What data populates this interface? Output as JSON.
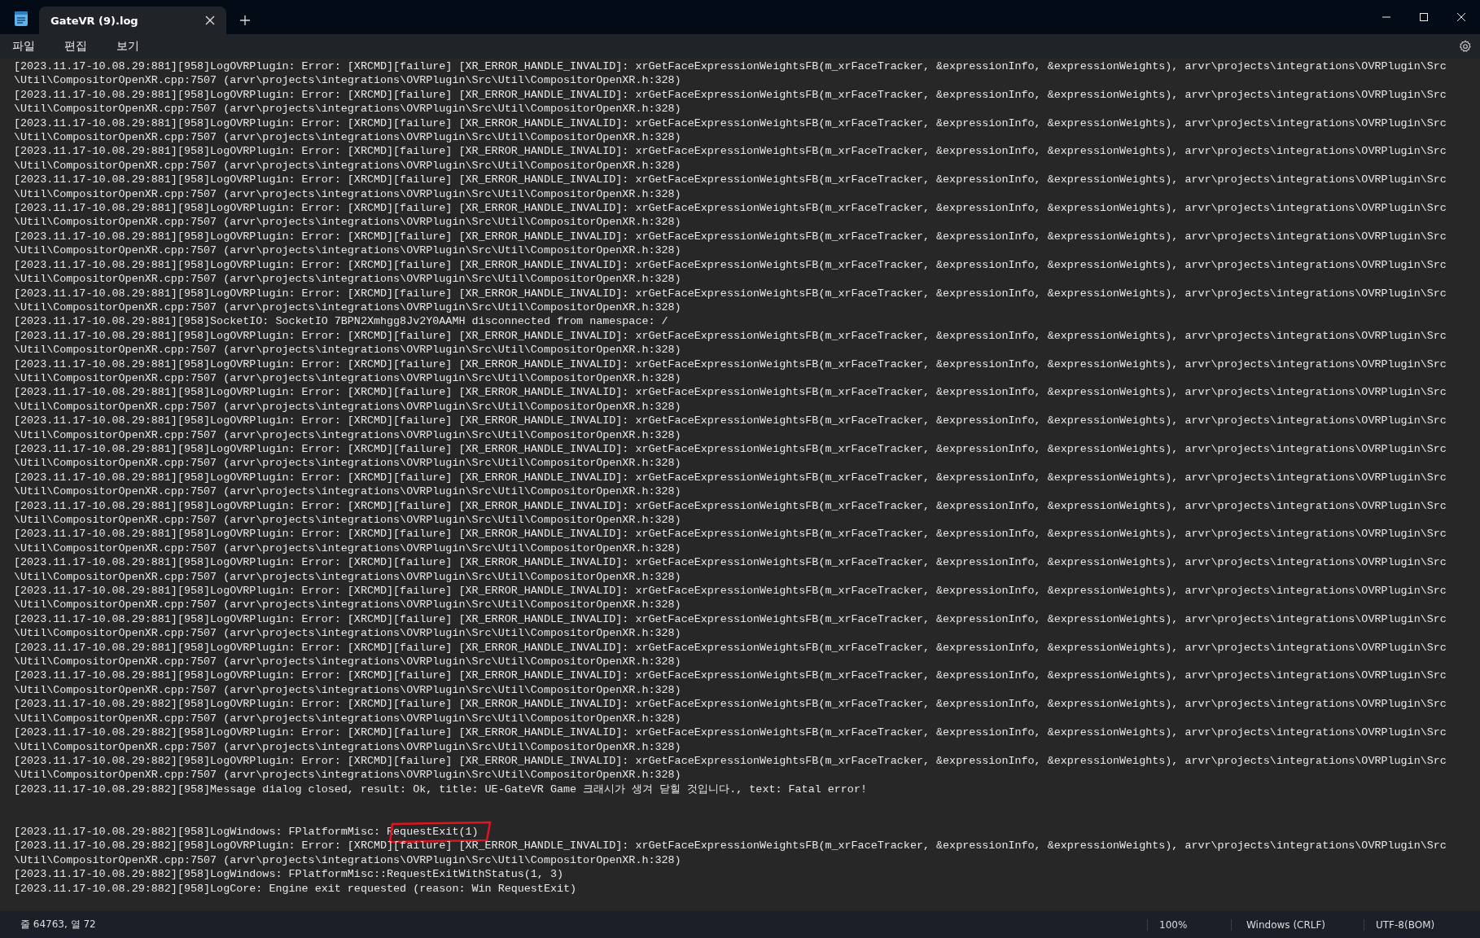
{
  "window": {
    "tabs": [
      {
        "title": "GateVR (9).log",
        "selected": true
      }
    ]
  },
  "menu": [
    "파일",
    "편집",
    "보기"
  ],
  "editor": {
    "lines": [
      {
        "text": "[2023.11.17-10.08.29:881][958]LogOVRPlugin: Error: [XRCMD][failure] [XR_ERROR_HANDLE_INVALID]: xrGetFaceExpressionWeightsFB(m_xrFaceTracker, &expressionInfo, &expressionWeights), arvr\\projects\\integrations\\OVRPlugin\\Src",
        "gap_before": false,
        "circled": false
      },
      {
        "text": "\\Util\\CompositorOpenXR.cpp:7507 (arvr\\projects\\integrations\\OVRPlugin\\Src\\Util\\CompositorOpenXR.h:328)",
        "gap_before": false,
        "circled": false
      },
      {
        "text": "[2023.11.17-10.08.29:881][958]LogOVRPlugin: Error: [XRCMD][failure] [XR_ERROR_HANDLE_INVALID]: xrGetFaceExpressionWeightsFB(m_xrFaceTracker, &expressionInfo, &expressionWeights), arvr\\projects\\integrations\\OVRPlugin\\Src",
        "gap_before": false,
        "circled": false
      },
      {
        "text": "\\Util\\CompositorOpenXR.cpp:7507 (arvr\\projects\\integrations\\OVRPlugin\\Src\\Util\\CompositorOpenXR.h:328)",
        "gap_before": false,
        "circled": false
      },
      {
        "text": "[2023.11.17-10.08.29:881][958]LogOVRPlugin: Error: [XRCMD][failure] [XR_ERROR_HANDLE_INVALID]: xrGetFaceExpressionWeightsFB(m_xrFaceTracker, &expressionInfo, &expressionWeights), arvr\\projects\\integrations\\OVRPlugin\\Src",
        "gap_before": false,
        "circled": false
      },
      {
        "text": "\\Util\\CompositorOpenXR.cpp:7507 (arvr\\projects\\integrations\\OVRPlugin\\Src\\Util\\CompositorOpenXR.h:328)",
        "gap_before": false,
        "circled": false
      },
      {
        "text": "[2023.11.17-10.08.29:881][958]LogOVRPlugin: Error: [XRCMD][failure] [XR_ERROR_HANDLE_INVALID]: xrGetFaceExpressionWeightsFB(m_xrFaceTracker, &expressionInfo, &expressionWeights), arvr\\projects\\integrations\\OVRPlugin\\Src",
        "gap_before": false,
        "circled": false
      },
      {
        "text": "\\Util\\CompositorOpenXR.cpp:7507 (arvr\\projects\\integrations\\OVRPlugin\\Src\\Util\\CompositorOpenXR.h:328)",
        "gap_before": false,
        "circled": false
      },
      {
        "text": "[2023.11.17-10.08.29:881][958]LogOVRPlugin: Error: [XRCMD][failure] [XR_ERROR_HANDLE_INVALID]: xrGetFaceExpressionWeightsFB(m_xrFaceTracker, &expressionInfo, &expressionWeights), arvr\\projects\\integrations\\OVRPlugin\\Src",
        "gap_before": false,
        "circled": false
      },
      {
        "text": "\\Util\\CompositorOpenXR.cpp:7507 (arvr\\projects\\integrations\\OVRPlugin\\Src\\Util\\CompositorOpenXR.h:328)",
        "gap_before": false,
        "circled": false
      },
      {
        "text": "[2023.11.17-10.08.29:881][958]LogOVRPlugin: Error: [XRCMD][failure] [XR_ERROR_HANDLE_INVALID]: xrGetFaceExpressionWeightsFB(m_xrFaceTracker, &expressionInfo, &expressionWeights), arvr\\projects\\integrations\\OVRPlugin\\Src",
        "gap_before": false,
        "circled": false
      },
      {
        "text": "\\Util\\CompositorOpenXR.cpp:7507 (arvr\\projects\\integrations\\OVRPlugin\\Src\\Util\\CompositorOpenXR.h:328)",
        "gap_before": false,
        "circled": false
      },
      {
        "text": "[2023.11.17-10.08.29:881][958]LogOVRPlugin: Error: [XRCMD][failure] [XR_ERROR_HANDLE_INVALID]: xrGetFaceExpressionWeightsFB(m_xrFaceTracker, &expressionInfo, &expressionWeights), arvr\\projects\\integrations\\OVRPlugin\\Src",
        "gap_before": false,
        "circled": false
      },
      {
        "text": "\\Util\\CompositorOpenXR.cpp:7507 (arvr\\projects\\integrations\\OVRPlugin\\Src\\Util\\CompositorOpenXR.h:328)",
        "gap_before": false,
        "circled": false
      },
      {
        "text": "[2023.11.17-10.08.29:881][958]LogOVRPlugin: Error: [XRCMD][failure] [XR_ERROR_HANDLE_INVALID]: xrGetFaceExpressionWeightsFB(m_xrFaceTracker, &expressionInfo, &expressionWeights), arvr\\projects\\integrations\\OVRPlugin\\Src",
        "gap_before": false,
        "circled": false
      },
      {
        "text": "\\Util\\CompositorOpenXR.cpp:7507 (arvr\\projects\\integrations\\OVRPlugin\\Src\\Util\\CompositorOpenXR.h:328)",
        "gap_before": false,
        "circled": false
      },
      {
        "text": "[2023.11.17-10.08.29:881][958]LogOVRPlugin: Error: [XRCMD][failure] [XR_ERROR_HANDLE_INVALID]: xrGetFaceExpressionWeightsFB(m_xrFaceTracker, &expressionInfo, &expressionWeights), arvr\\projects\\integrations\\OVRPlugin\\Src",
        "gap_before": false,
        "circled": false
      },
      {
        "text": "\\Util\\CompositorOpenXR.cpp:7507 (arvr\\projects\\integrations\\OVRPlugin\\Src\\Util\\CompositorOpenXR.h:328)",
        "gap_before": false,
        "circled": false
      },
      {
        "text": "[2023.11.17-10.08.29:881][958]SocketIO: SocketIO 7BPN2Xmhgg8Jv2Y0AAMH disconnected from namespace: /",
        "gap_before": false,
        "circled": false
      },
      {
        "text": "[2023.11.17-10.08.29:881][958]LogOVRPlugin: Error: [XRCMD][failure] [XR_ERROR_HANDLE_INVALID]: xrGetFaceExpressionWeightsFB(m_xrFaceTracker, &expressionInfo, &expressionWeights), arvr\\projects\\integrations\\OVRPlugin\\Src",
        "gap_before": false,
        "circled": false
      },
      {
        "text": "\\Util\\CompositorOpenXR.cpp:7507 (arvr\\projects\\integrations\\OVRPlugin\\Src\\Util\\CompositorOpenXR.h:328)",
        "gap_before": false,
        "circled": false
      },
      {
        "text": "[2023.11.17-10.08.29:881][958]LogOVRPlugin: Error: [XRCMD][failure] [XR_ERROR_HANDLE_INVALID]: xrGetFaceExpressionWeightsFB(m_xrFaceTracker, &expressionInfo, &expressionWeights), arvr\\projects\\integrations\\OVRPlugin\\Src",
        "gap_before": false,
        "circled": false
      },
      {
        "text": "\\Util\\CompositorOpenXR.cpp:7507 (arvr\\projects\\integrations\\OVRPlugin\\Src\\Util\\CompositorOpenXR.h:328)",
        "gap_before": false,
        "circled": false
      },
      {
        "text": "[2023.11.17-10.08.29:881][958]LogOVRPlugin: Error: [XRCMD][failure] [XR_ERROR_HANDLE_INVALID]: xrGetFaceExpressionWeightsFB(m_xrFaceTracker, &expressionInfo, &expressionWeights), arvr\\projects\\integrations\\OVRPlugin\\Src",
        "gap_before": false,
        "circled": false
      },
      {
        "text": "\\Util\\CompositorOpenXR.cpp:7507 (arvr\\projects\\integrations\\OVRPlugin\\Src\\Util\\CompositorOpenXR.h:328)",
        "gap_before": false,
        "circled": false
      },
      {
        "text": "[2023.11.17-10.08.29:881][958]LogOVRPlugin: Error: [XRCMD][failure] [XR_ERROR_HANDLE_INVALID]: xrGetFaceExpressionWeightsFB(m_xrFaceTracker, &expressionInfo, &expressionWeights), arvr\\projects\\integrations\\OVRPlugin\\Src",
        "gap_before": false,
        "circled": false
      },
      {
        "text": "\\Util\\CompositorOpenXR.cpp:7507 (arvr\\projects\\integrations\\OVRPlugin\\Src\\Util\\CompositorOpenXR.h:328)",
        "gap_before": false,
        "circled": false
      },
      {
        "text": "[2023.11.17-10.08.29:881][958]LogOVRPlugin: Error: [XRCMD][failure] [XR_ERROR_HANDLE_INVALID]: xrGetFaceExpressionWeightsFB(m_xrFaceTracker, &expressionInfo, &expressionWeights), arvr\\projects\\integrations\\OVRPlugin\\Src",
        "gap_before": false,
        "circled": false
      },
      {
        "text": "\\Util\\CompositorOpenXR.cpp:7507 (arvr\\projects\\integrations\\OVRPlugin\\Src\\Util\\CompositorOpenXR.h:328)",
        "gap_before": false,
        "circled": false
      },
      {
        "text": "[2023.11.17-10.08.29:881][958]LogOVRPlugin: Error: [XRCMD][failure] [XR_ERROR_HANDLE_INVALID]: xrGetFaceExpressionWeightsFB(m_xrFaceTracker, &expressionInfo, &expressionWeights), arvr\\projects\\integrations\\OVRPlugin\\Src",
        "gap_before": false,
        "circled": false
      },
      {
        "text": "\\Util\\CompositorOpenXR.cpp:7507 (arvr\\projects\\integrations\\OVRPlugin\\Src\\Util\\CompositorOpenXR.h:328)",
        "gap_before": false,
        "circled": false
      },
      {
        "text": "[2023.11.17-10.08.29:881][958]LogOVRPlugin: Error: [XRCMD][failure] [XR_ERROR_HANDLE_INVALID]: xrGetFaceExpressionWeightsFB(m_xrFaceTracker, &expressionInfo, &expressionWeights), arvr\\projects\\integrations\\OVRPlugin\\Src",
        "gap_before": false,
        "circled": false
      },
      {
        "text": "\\Util\\CompositorOpenXR.cpp:7507 (arvr\\projects\\integrations\\OVRPlugin\\Src\\Util\\CompositorOpenXR.h:328)",
        "gap_before": false,
        "circled": false
      },
      {
        "text": "[2023.11.17-10.08.29:881][958]LogOVRPlugin: Error: [XRCMD][failure] [XR_ERROR_HANDLE_INVALID]: xrGetFaceExpressionWeightsFB(m_xrFaceTracker, &expressionInfo, &expressionWeights), arvr\\projects\\integrations\\OVRPlugin\\Src",
        "gap_before": false,
        "circled": false
      },
      {
        "text": "\\Util\\CompositorOpenXR.cpp:7507 (arvr\\projects\\integrations\\OVRPlugin\\Src\\Util\\CompositorOpenXR.h:328)",
        "gap_before": false,
        "circled": false
      },
      {
        "text": "[2023.11.17-10.08.29:881][958]LogOVRPlugin: Error: [XRCMD][failure] [XR_ERROR_HANDLE_INVALID]: xrGetFaceExpressionWeightsFB(m_xrFaceTracker, &expressionInfo, &expressionWeights), arvr\\projects\\integrations\\OVRPlugin\\Src",
        "gap_before": false,
        "circled": false
      },
      {
        "text": "\\Util\\CompositorOpenXR.cpp:7507 (arvr\\projects\\integrations\\OVRPlugin\\Src\\Util\\CompositorOpenXR.h:328)",
        "gap_before": false,
        "circled": false
      },
      {
        "text": "[2023.11.17-10.08.29:881][958]LogOVRPlugin: Error: [XRCMD][failure] [XR_ERROR_HANDLE_INVALID]: xrGetFaceExpressionWeightsFB(m_xrFaceTracker, &expressionInfo, &expressionWeights), arvr\\projects\\integrations\\OVRPlugin\\Src",
        "gap_before": false,
        "circled": false
      },
      {
        "text": "\\Util\\CompositorOpenXR.cpp:7507 (arvr\\projects\\integrations\\OVRPlugin\\Src\\Util\\CompositorOpenXR.h:328)",
        "gap_before": false,
        "circled": false
      },
      {
        "text": "[2023.11.17-10.08.29:881][958]LogOVRPlugin: Error: [XRCMD][failure] [XR_ERROR_HANDLE_INVALID]: xrGetFaceExpressionWeightsFB(m_xrFaceTracker, &expressionInfo, &expressionWeights), arvr\\projects\\integrations\\OVRPlugin\\Src",
        "gap_before": false,
        "circled": false
      },
      {
        "text": "\\Util\\CompositorOpenXR.cpp:7507 (arvr\\projects\\integrations\\OVRPlugin\\Src\\Util\\CompositorOpenXR.h:328)",
        "gap_before": false,
        "circled": false
      },
      {
        "text": "[2023.11.17-10.08.29:881][958]LogOVRPlugin: Error: [XRCMD][failure] [XR_ERROR_HANDLE_INVALID]: xrGetFaceExpressionWeightsFB(m_xrFaceTracker, &expressionInfo, &expressionWeights), arvr\\projects\\integrations\\OVRPlugin\\Src",
        "gap_before": false,
        "circled": false
      },
      {
        "text": "\\Util\\CompositorOpenXR.cpp:7507 (arvr\\projects\\integrations\\OVRPlugin\\Src\\Util\\CompositorOpenXR.h:328)",
        "gap_before": false,
        "circled": false
      },
      {
        "text": "[2023.11.17-10.08.29:881][958]LogOVRPlugin: Error: [XRCMD][failure] [XR_ERROR_HANDLE_INVALID]: xrGetFaceExpressionWeightsFB(m_xrFaceTracker, &expressionInfo, &expressionWeights), arvr\\projects\\integrations\\OVRPlugin\\Src",
        "gap_before": false,
        "circled": false
      },
      {
        "text": "\\Util\\CompositorOpenXR.cpp:7507 (arvr\\projects\\integrations\\OVRPlugin\\Src\\Util\\CompositorOpenXR.h:328)",
        "gap_before": false,
        "circled": false
      },
      {
        "text": "[2023.11.17-10.08.29:882][958]LogOVRPlugin: Error: [XRCMD][failure] [XR_ERROR_HANDLE_INVALID]: xrGetFaceExpressionWeightsFB(m_xrFaceTracker, &expressionInfo, &expressionWeights), arvr\\projects\\integrations\\OVRPlugin\\Src",
        "gap_before": false,
        "circled": false
      },
      {
        "text": "\\Util\\CompositorOpenXR.cpp:7507 (arvr\\projects\\integrations\\OVRPlugin\\Src\\Util\\CompositorOpenXR.h:328)",
        "gap_before": false,
        "circled": false
      },
      {
        "text": "[2023.11.17-10.08.29:882][958]LogOVRPlugin: Error: [XRCMD][failure] [XR_ERROR_HANDLE_INVALID]: xrGetFaceExpressionWeightsFB(m_xrFaceTracker, &expressionInfo, &expressionWeights), arvr\\projects\\integrations\\OVRPlugin\\Src",
        "gap_before": false,
        "circled": false
      },
      {
        "text": "\\Util\\CompositorOpenXR.cpp:7507 (arvr\\projects\\integrations\\OVRPlugin\\Src\\Util\\CompositorOpenXR.h:328)",
        "gap_before": false,
        "circled": false
      },
      {
        "text": "[2023.11.17-10.08.29:882][958]LogOVRPlugin: Error: [XRCMD][failure] [XR_ERROR_HANDLE_INVALID]: xrGetFaceExpressionWeightsFB(m_xrFaceTracker, &expressionInfo, &expressionWeights), arvr\\projects\\integrations\\OVRPlugin\\Src",
        "gap_before": false,
        "circled": false
      },
      {
        "text": "\\Util\\CompositorOpenXR.cpp:7507 (arvr\\projects\\integrations\\OVRPlugin\\Src\\Util\\CompositorOpenXR.h:328)",
        "gap_before": false,
        "circled": false
      },
      {
        "text": "[2023.11.17-10.08.29:882][958]Message dialog closed, result: Ok, title: UE-GateVR Game 크래시가 생겨 닫힐 것입니다., text: Fatal error!",
        "gap_before": false,
        "circled": false
      },
      {
        "text": "[2023.11.17-10.08.29:882][958]LogWindows: FPlatformMisc: RequestExit(1)",
        "gap_before": true,
        "circled": true
      },
      {
        "text": "[2023.11.17-10.08.29:882][958]LogOVRPlugin: Error: [XRCMD][failure] [XR_ERROR_HANDLE_INVALID]: xrGetFaceExpressionWeightsFB(m_xrFaceTracker, &expressionInfo, &expressionWeights), arvr\\projects\\integrations\\OVRPlugin\\Src",
        "gap_before": false,
        "circled": false
      },
      {
        "text": "\\Util\\CompositorOpenXR.cpp:7507 (arvr\\projects\\integrations\\OVRPlugin\\Src\\Util\\CompositorOpenXR.h:328)",
        "gap_before": false,
        "circled": false
      },
      {
        "text": "[2023.11.17-10.08.29:882][958]LogWindows: FPlatformMisc::RequestExitWithStatus(1, 3)",
        "gap_before": false,
        "circled": false
      },
      {
        "text": "[2023.11.17-10.08.29:882][958]LogCore: Engine exit requested (reason: Win RequestExit)",
        "gap_before": false,
        "circled": false
      }
    ]
  },
  "status_bar": {
    "position": "줄 64763, 열 72",
    "zoom": "100%",
    "line_ending": "Windows (CRLF)",
    "encoding": "UTF-8(BOM)"
  }
}
